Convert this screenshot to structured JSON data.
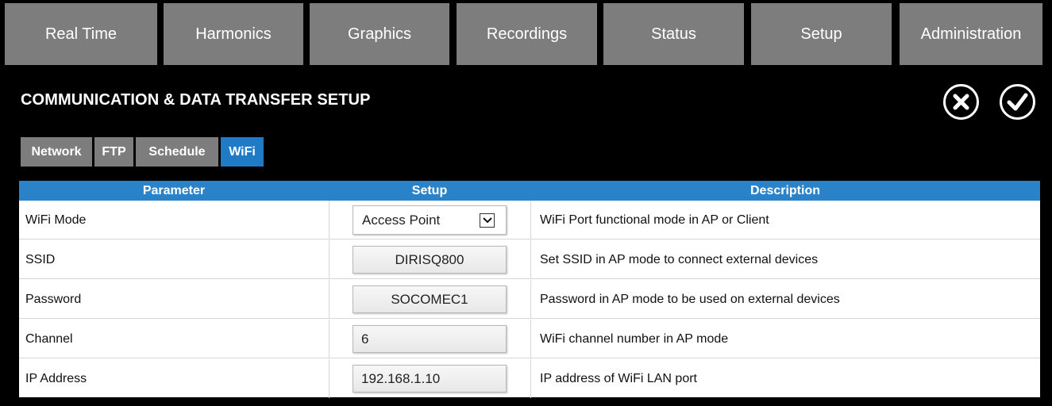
{
  "nav": {
    "items": [
      {
        "label": "Real Time"
      },
      {
        "label": "Harmonics"
      },
      {
        "label": "Graphics"
      },
      {
        "label": "Recordings"
      },
      {
        "label": "Status"
      },
      {
        "label": "Setup"
      },
      {
        "label": "Administration"
      }
    ],
    "background": "#7d7d7d"
  },
  "page": {
    "title": "COMMUNICATION & DATA TRANSFER SETUP",
    "cancel_icon": "close-circle-icon",
    "confirm_icon": "check-circle-icon"
  },
  "subtabs": {
    "items": [
      {
        "label": "Network",
        "active": false
      },
      {
        "label": "FTP",
        "active": false
      },
      {
        "label": "Schedule",
        "active": false
      },
      {
        "label": "WiFi",
        "active": true
      }
    ],
    "active_color": "#1f7bc6"
  },
  "table": {
    "headers": {
      "parameter": "Parameter",
      "setup": "Setup",
      "description": "Description"
    },
    "header_color": "#2a83c9",
    "rows": [
      {
        "parameter": "WiFi Mode",
        "setup": "Access Point",
        "control": "select",
        "description": "WiFi Port functional mode in AP or Client"
      },
      {
        "parameter": "SSID",
        "setup": "DIRISQ800",
        "control": "text",
        "description": "Set SSID in AP mode to connect external devices"
      },
      {
        "parameter": "Password",
        "setup": "SOCOMEC1",
        "control": "text",
        "description": "Password in AP mode to be used on external devices"
      },
      {
        "parameter": "Channel",
        "setup": "6",
        "control": "text",
        "description": "WiFi channel number in AP mode"
      },
      {
        "parameter": "IP Address",
        "setup": "192.168.1.10",
        "control": "text",
        "description": "IP address of WiFi LAN port"
      }
    ]
  }
}
